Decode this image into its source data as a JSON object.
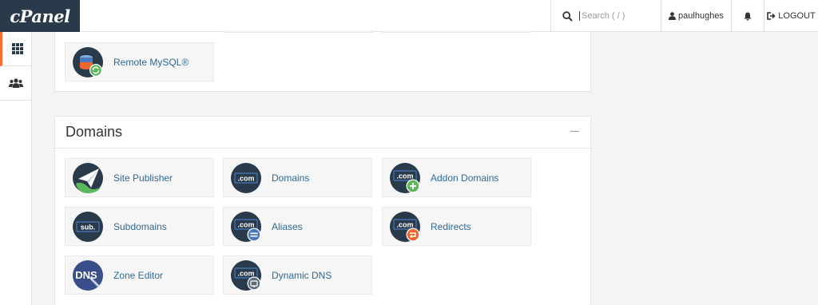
{
  "header": {
    "logo_text": "cPanel",
    "search_placeholder": "Search ( / )",
    "user": "paulhughes",
    "logout": "LOGOUT"
  },
  "sidebar": {
    "items": [
      {
        "name": "tools",
        "icon": "grid-icon",
        "active": true
      },
      {
        "name": "users",
        "icon": "users-icon",
        "active": false
      }
    ]
  },
  "databases": {
    "items": [
      {
        "label": "Remote MySQL®",
        "icon": "remote-mysql-icon"
      }
    ]
  },
  "domains": {
    "title": "Domains",
    "items": [
      {
        "label": "Site Publisher",
        "icon": "site-publisher-icon"
      },
      {
        "label": "Domains",
        "icon": "domains-icon"
      },
      {
        "label": "Addon Domains",
        "icon": "addon-domains-icon"
      },
      {
        "label": "Subdomains",
        "icon": "subdomains-icon"
      },
      {
        "label": "Aliases",
        "icon": "aliases-icon"
      },
      {
        "label": "Redirects",
        "icon": "redirects-icon"
      },
      {
        "label": "Zone Editor",
        "icon": "zone-editor-icon"
      },
      {
        "label": "Dynamic DNS",
        "icon": "dynamic-dns-icon"
      }
    ],
    "icon_texts": {
      "com": ".com",
      "sub": "sub.",
      "dns": "DNS"
    }
  },
  "colors": {
    "header_logo_bg": "#293a4a",
    "accent": "#ff6c2c",
    "link": "#2f6a95",
    "icon_dark": "#293a4a",
    "icon_green": "#5cb85c",
    "icon_orange": "#ef6730",
    "icon_blue": "#4a79bc"
  }
}
